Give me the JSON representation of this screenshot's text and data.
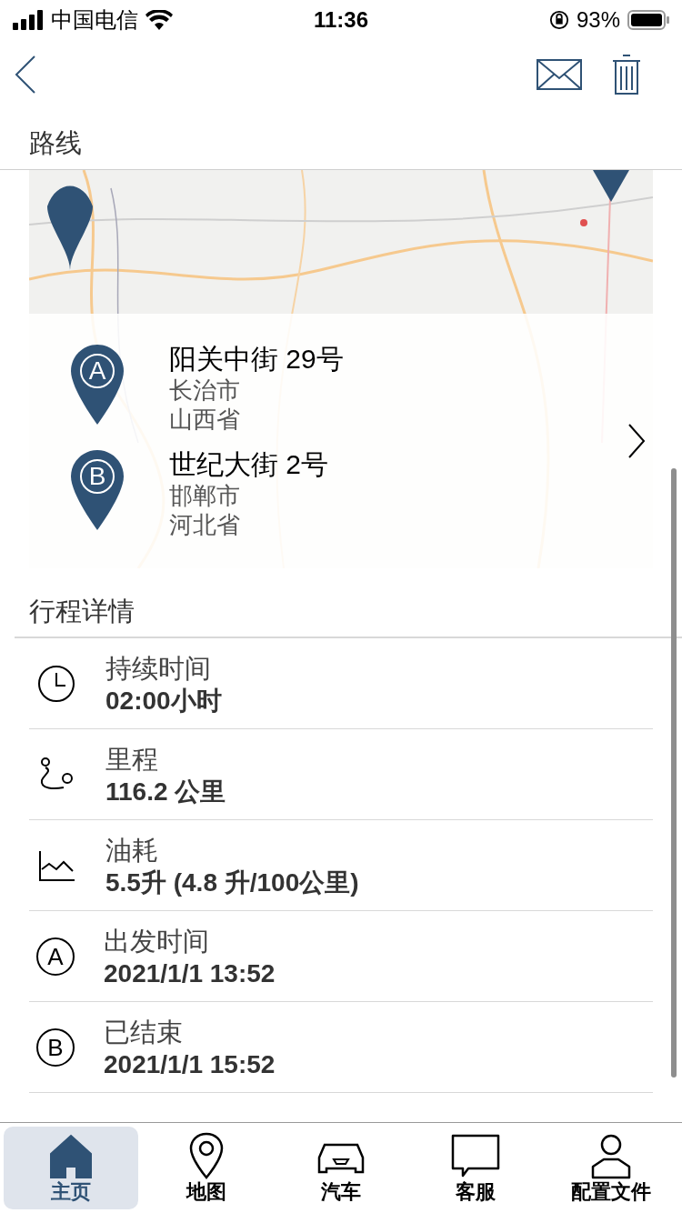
{
  "status_bar": {
    "carrier": "中国电信",
    "time": "11:36",
    "battery": "93%"
  },
  "route": {
    "title": "路线",
    "waypoints": [
      {
        "letter": "A",
        "street": "阳关中街 29号",
        "city": "长治市",
        "province": "山西省"
      },
      {
        "letter": "B",
        "street": "世纪大街 2号",
        "city": "邯郸市",
        "province": "河北省"
      }
    ]
  },
  "details": {
    "title": "行程详情",
    "rows": [
      {
        "kind": "clock",
        "label": "持续时间",
        "value": "02:00小时"
      },
      {
        "kind": "route",
        "label": "里程",
        "value": "116.2 公里"
      },
      {
        "kind": "chart",
        "label": "油耗",
        "value": "5.5升 (4.8 升/100公里)"
      },
      {
        "kind": "letter",
        "letter": "A",
        "label": "出发时间",
        "value": "2021/1/1 13:52"
      },
      {
        "kind": "letter",
        "letter": "B",
        "label": "已结束",
        "value": "2021/1/1 15:52"
      }
    ]
  },
  "tab_bar": [
    {
      "kind": "home",
      "label": "主页",
      "selected": true
    },
    {
      "kind": "map",
      "label": "地图",
      "selected": false
    },
    {
      "kind": "car",
      "label": "汽车",
      "selected": false
    },
    {
      "kind": "chat",
      "label": "客服",
      "selected": false
    },
    {
      "kind": "profile",
      "label": "配置文件",
      "selected": false
    }
  ]
}
